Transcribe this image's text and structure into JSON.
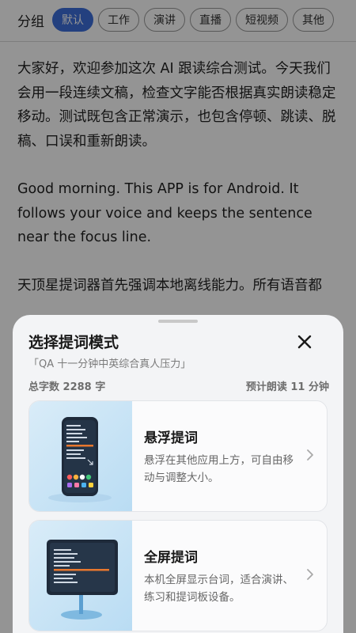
{
  "background": {
    "group_label": "分组",
    "chips": [
      "默认",
      "工作",
      "演讲",
      "直播",
      "短视频",
      "其他"
    ],
    "active_chip": 0,
    "paragraphs": [
      "大家好，欢迎参加这次 AI 跟读综合测试。今天我们会用一段连续文稿，检查文字能否根据真实朗读稳定移动。测试既包含正常演示，也包含停顿、跳读、脱稿、口误和重新朗读。",
      "Good morning. This APP is for Android. It follows your voice and keeps the sentence near the focus line.",
      "天顶星提词器首先强调本地离线能力。所有语音都"
    ]
  },
  "sheet": {
    "title": "选择提词模式",
    "subtitle": "「QA 十一分钟中英综合真人压力」",
    "word_count": "总字数 2288 字",
    "read_time": "预计朗读 11 分钟",
    "modes": [
      {
        "title": "悬浮提词",
        "desc": "悬浮在其他应用上方，可自由移动与调整大小。",
        "icon": "floating-phone-illustration"
      },
      {
        "title": "全屏提词",
        "desc": "本机全屏显示台词，适合演讲、练习和提词板设备。",
        "icon": "fullscreen-monitor-illustration"
      }
    ]
  },
  "colors": {
    "accent": "#3d6fdb",
    "highlight": "#e8772e"
  }
}
